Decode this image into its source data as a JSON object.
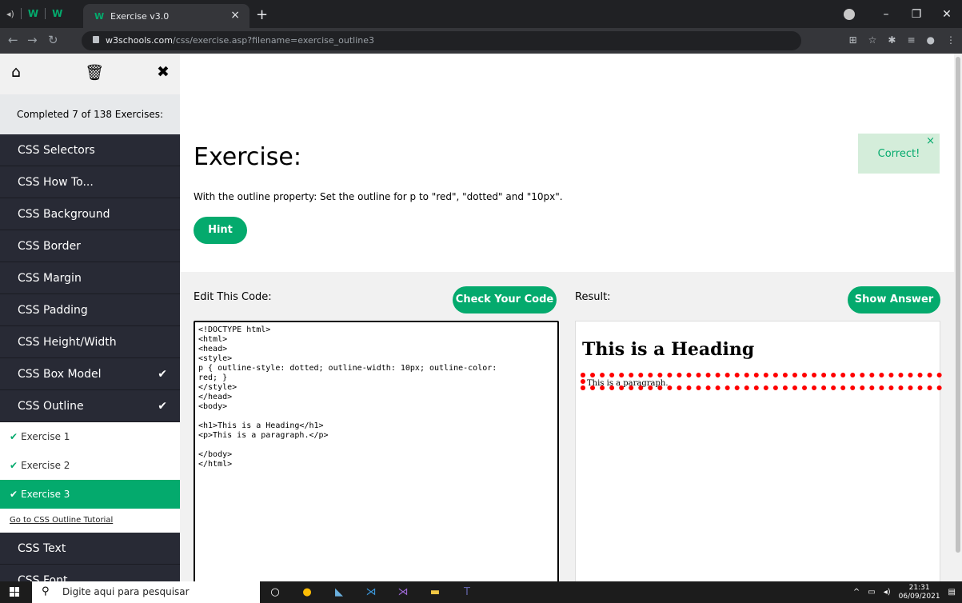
{
  "browser": {
    "tab_title": "Exercise v3.0",
    "url_host": "w3schools.com",
    "url_path": "/css/exercise.asp?filename=exercise_outline3"
  },
  "sidebar": {
    "progress": "Completed 7 of 138 Exercises:",
    "items": [
      {
        "label": "CSS Selectors"
      },
      {
        "label": "CSS How To..."
      },
      {
        "label": "CSS Background"
      },
      {
        "label": "CSS Border"
      },
      {
        "label": "CSS Margin"
      },
      {
        "label": "CSS Padding"
      },
      {
        "label": "CSS Height/Width"
      },
      {
        "label": "CSS Box Model"
      },
      {
        "label": "CSS Outline"
      }
    ],
    "sub_items": [
      {
        "label": "Exercise 1"
      },
      {
        "label": "Exercise 2"
      },
      {
        "label": "Exercise 3"
      }
    ],
    "tutorial_link": "Go to CSS Outline Tutorial",
    "items_after": [
      {
        "label": "CSS Text"
      },
      {
        "label": "CSS Font"
      }
    ]
  },
  "exercise": {
    "title": "Exercise:",
    "instruction": "With the outline property: Set the outline for p to \"red\", \"dotted\" and \"10px\".",
    "hint": "Hint",
    "correct": "Correct!"
  },
  "editor": {
    "label": "Edit This Code:",
    "check_button": "Check Your Code",
    "code": "<!DOCTYPE html>\n<html>\n<head>\n<style>\np { outline-style: dotted; outline-width: 10px; outline-color:\nred; }\n</style>\n</head>\n<body>\n\n<h1>This is a Heading</h1>\n<p>This is a paragraph.</p>\n\n</body>\n</html>"
  },
  "result": {
    "label": "Result:",
    "show_answer": "Show Answer",
    "heading": "This is a Heading",
    "paragraph": "This is a paragraph."
  },
  "taskbar": {
    "search_placeholder": "Digite aqui para pesquisar",
    "time": "21:31",
    "date": "06/09/2021"
  },
  "colors": {
    "accent": "#04aa6d",
    "sidebar_bg": "#282a35"
  }
}
